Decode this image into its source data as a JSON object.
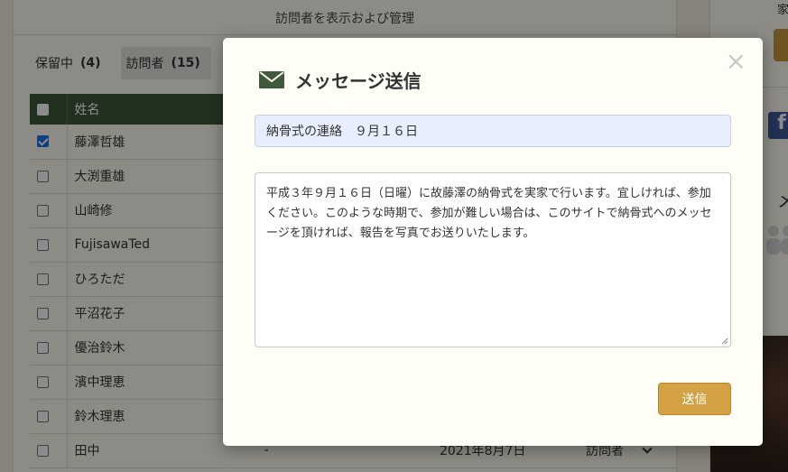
{
  "page": {
    "heading": "訪問者を表示および管理"
  },
  "tabs": [
    {
      "label": "保留中",
      "count": "(4)"
    },
    {
      "label": "訪問者",
      "count": "(15)"
    }
  ],
  "table": {
    "header_name": "姓名",
    "rows": [
      {
        "name": "藤澤哲雄",
        "checked": true
      },
      {
        "name": "大渕重雄",
        "checked": false
      },
      {
        "name": "山崎修",
        "checked": false
      },
      {
        "name": "FujisawaTed",
        "checked": false
      },
      {
        "name": "ひろただ",
        "checked": false
      },
      {
        "name": "平沼花子",
        "checked": false
      },
      {
        "name": "優治鈴木",
        "checked": false
      },
      {
        "name": "濱中理恵",
        "checked": false
      },
      {
        "name": "鈴木理恵",
        "checked": false
      },
      {
        "name": "田中",
        "checked": false,
        "dash": "-",
        "date": "2021年8月7日",
        "type": "訪問者"
      }
    ]
  },
  "right_panel": {
    "top_text": "家",
    "me_text": "メ",
    "fb_letter": "f"
  },
  "modal": {
    "title": "メッセージ送信",
    "close": "×",
    "subject": "納骨式の連絡　９月１６日",
    "body": "平成３年９月１６日（日曜）に故藤澤の納骨式を実家で行います。宜しければ、参加ください。このような時期で、参加が難しい場合は、このサイトで納骨式へのメッセージを頂ければ、報告を写真でお送りいたします。",
    "send_label": "送信"
  },
  "colors": {
    "header_green": "#3f5a3a",
    "send_gold": "#d4a242",
    "subject_bg": "#e8eefc",
    "check_blue": "#1a73e8"
  }
}
